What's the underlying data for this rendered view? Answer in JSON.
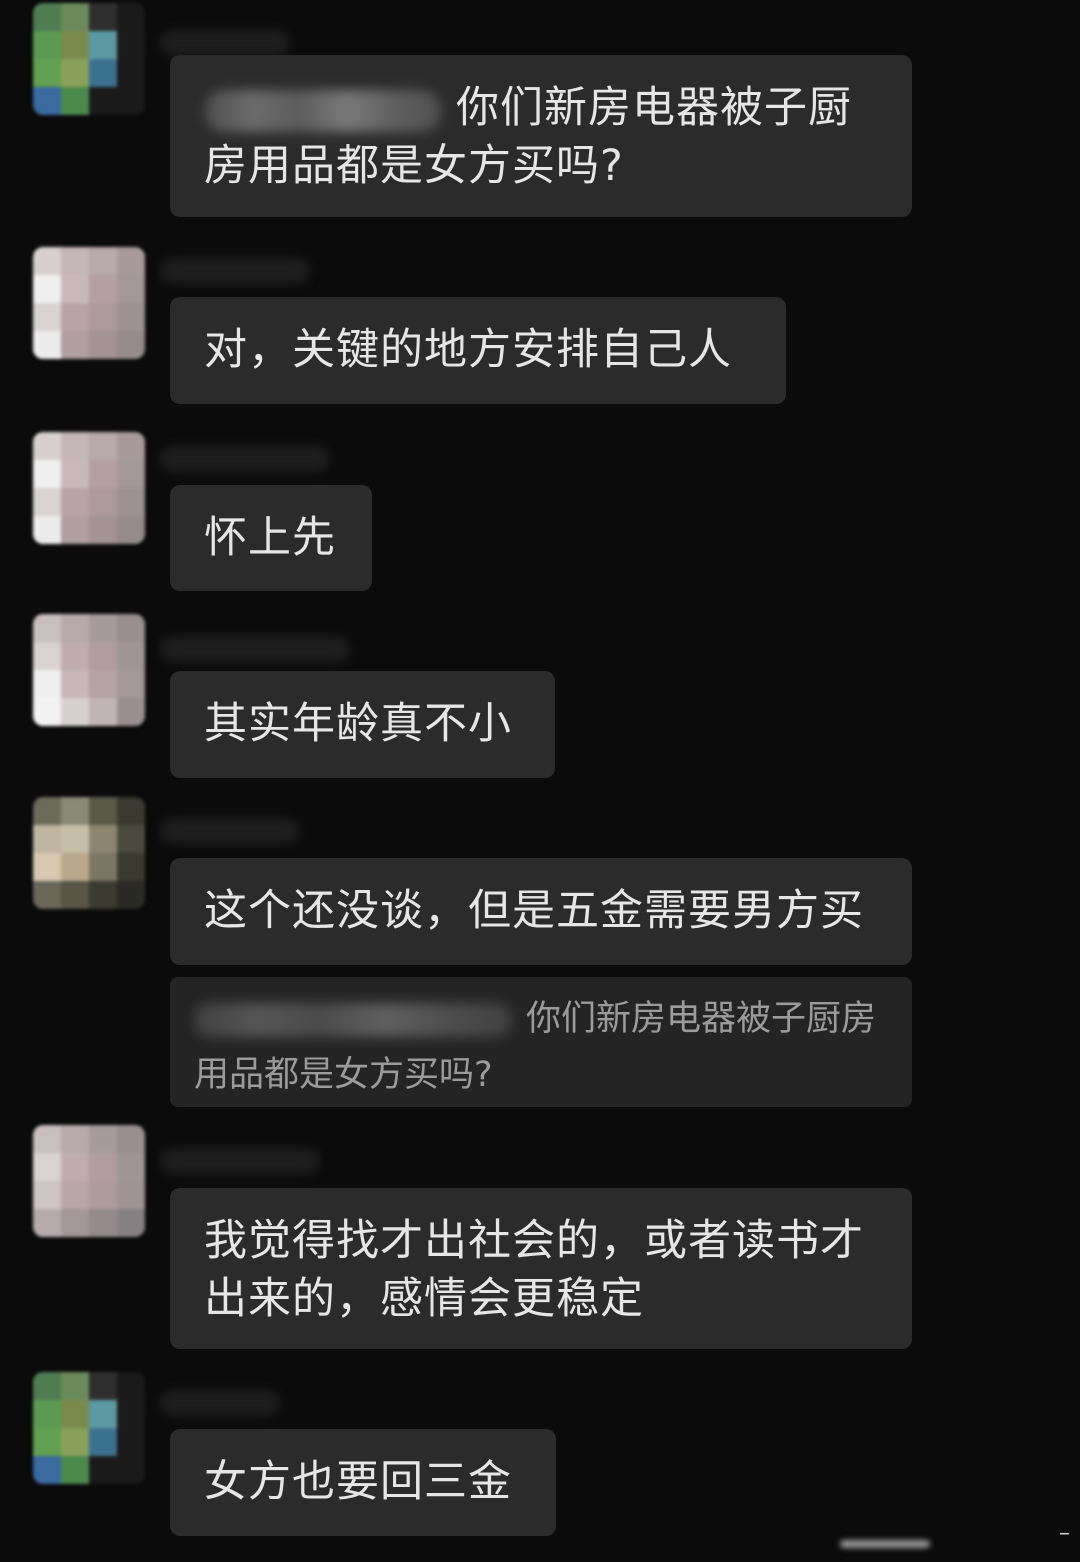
{
  "messages": [
    {
      "text": "你们新房电器被子厨房用品都是女方买吗?",
      "line1": "你们新房电器被子厨",
      "line2": "房用品都是女方买吗?",
      "sender": "masked"
    },
    {
      "text": "对，关键的地方安排自己人"
    },
    {
      "text": "怀上先"
    },
    {
      "text": "其实年龄真不小"
    },
    {
      "text": "这个还没谈，但是五金需要男方买"
    },
    {
      "quote_line1": "你们新房电器被子厨房",
      "quote_line2": "用品都是女方买吗?"
    },
    {
      "line1": "我觉得找才出社会的，或者读书才",
      "line2": "出来的，感情会更稳定"
    },
    {
      "text": "女方也要回三金"
    }
  ],
  "colors": {
    "background": "#0b0b0b",
    "bubble": "#2b2b2b",
    "bubble_text": "#e6e6e6",
    "quote_bubble": "#242424",
    "quote_text": "#9b9b9b"
  },
  "icons": {
    "avatar": "pixelated-avatar-icon",
    "corner": "minus-icon"
  },
  "corner_mark": "–"
}
